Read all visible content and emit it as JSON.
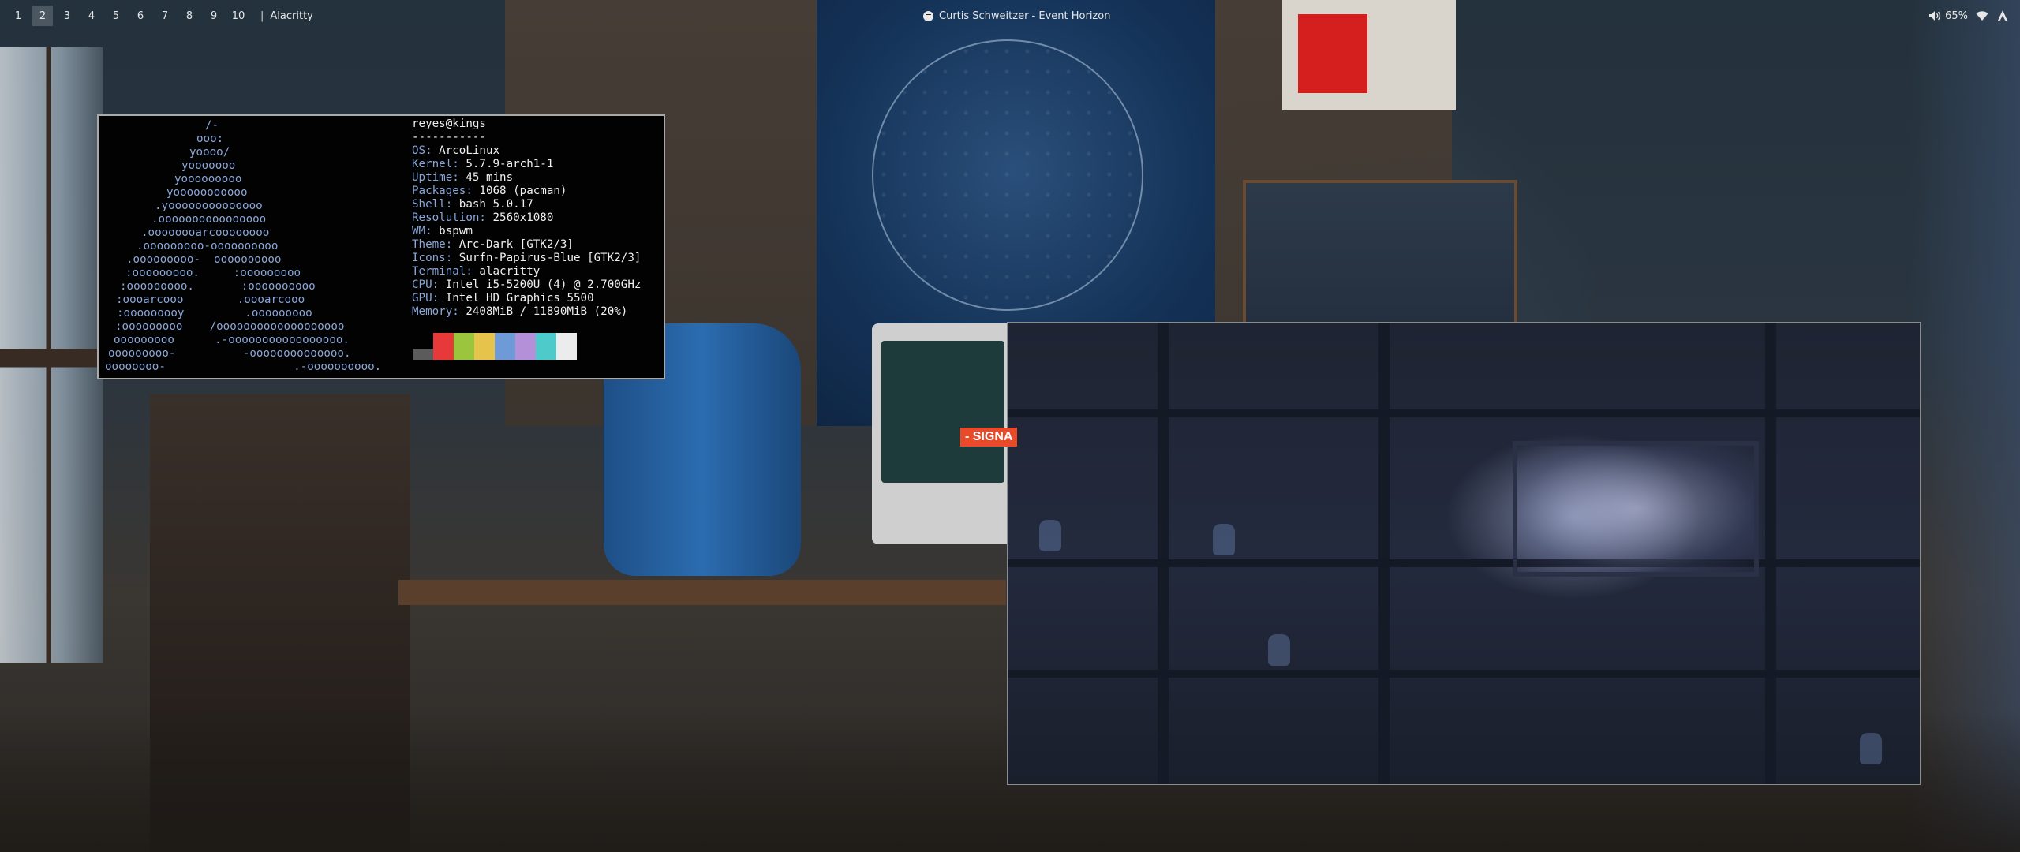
{
  "bar": {
    "workspaces": [
      "1",
      "2",
      "3",
      "4",
      "5",
      "6",
      "7",
      "8",
      "9",
      "10"
    ],
    "active_workspace": "2",
    "separator": "|",
    "window_title": "Alacritty",
    "media": "Curtis Schweitzer - Event Horizon",
    "volume": "65%",
    "icons": [
      "spotify-icon",
      "volume-icon",
      "wifi-icon",
      "arch-logo-icon"
    ]
  },
  "terminal": {
    "logo_lines": [
      "            /-",
      "           ooo:",
      "          yoooo/",
      "         yooooooo",
      "        yooooooooo",
      "       yooooooooooo",
      "     .yoooooooooooooo",
      "    .oooooooooooooooo",
      "   .oooooooarcoooooooo",
      "  .ooooooooo-oooooooooo",
      " .ooooooooo-  oooooooooo",
      ":ooooooooo.     :ooooooooo",
      ":ooooooooo.       :oooooooooo",
      " :oooarcooo        .oooarcooo",
      " :ooooooooy         .ooooooooo",
      ":ooooooooo    /ooooooooooooooooooo",
      "ooooooooo      .-ooooooooooooooooo.",
      " ooooooooo-          -oooooooooooooo.",
      "oooooooo-                   .-oooooooooo."
    ],
    "logo_indent": [
      127,
      116,
      107,
      97,
      88,
      78,
      63,
      59,
      46,
      40,
      27,
      26,
      19,
      14,
      15,
      13,
      11,
      4,
      0
    ],
    "host": "reyes@kings",
    "divider": "-----------",
    "info": [
      {
        "label": "OS:",
        "value": "ArcoLinux"
      },
      {
        "label": "Kernel:",
        "value": "5.7.9-arch1-1"
      },
      {
        "label": "Uptime:",
        "value": "45 mins"
      },
      {
        "label": "Packages:",
        "value": "1068 (pacman)"
      },
      {
        "label": "Shell:",
        "value": "bash 5.0.17"
      },
      {
        "label": "Resolution:",
        "value": "2560x1080"
      },
      {
        "label": "WM:",
        "value": "bspwm"
      },
      {
        "label": "Theme:",
        "value": "Arc-Dark [GTK2/3]"
      },
      {
        "label": "Icons:",
        "value": "Surfn-Papirus-Blue [GTK2/3]"
      },
      {
        "label": "Terminal:",
        "value": "alacritty"
      },
      {
        "label": "CPU:",
        "value": "Intel i5-5200U (4) @ 2.700GHz"
      },
      {
        "label": "GPU:",
        "value": "Intel HD Graphics 5500"
      },
      {
        "label": "Memory:",
        "value": "2408MiB / 11890MiB (20%)"
      }
    ],
    "palette": [
      "#5b5b5b",
      "#e8393a",
      "#9bc53d",
      "#e6c34a",
      "#6f9ad8",
      "#b390d8",
      "#4ecacb",
      "#ececec"
    ]
  },
  "wallpaper": {
    "overlay_text": "- SIGNA"
  }
}
